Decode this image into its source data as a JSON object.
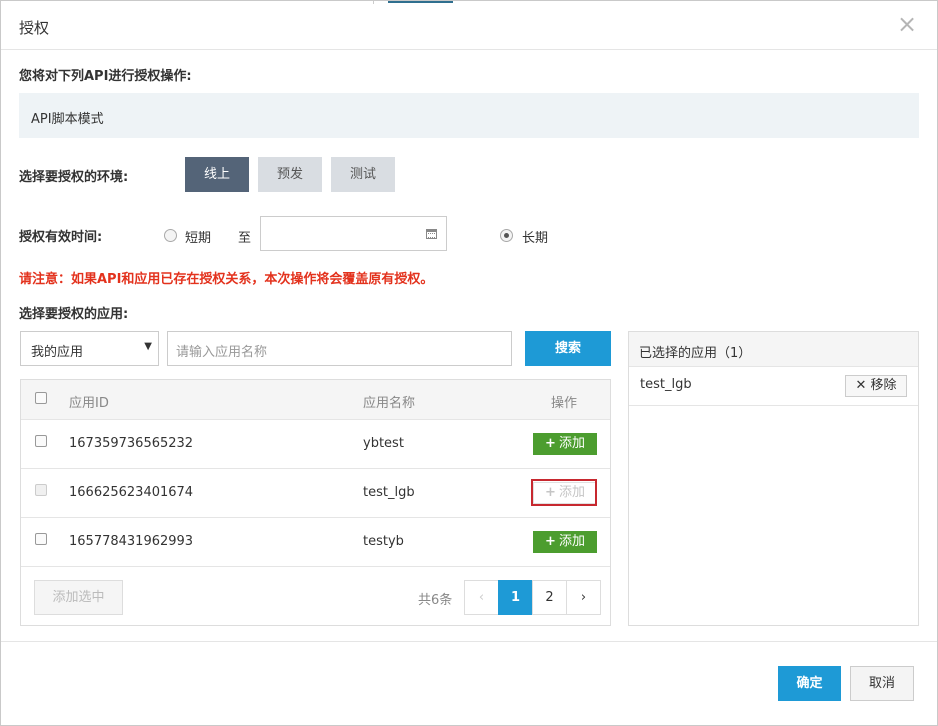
{
  "dialog": {
    "title": "授权",
    "close_glyph": "×"
  },
  "api_section": {
    "label": "您将对下列API进行授权操作:",
    "api_name": "API脚本模式"
  },
  "environment": {
    "label": "选择要授权的环境:",
    "options": [
      {
        "label": "线上",
        "active": true
      },
      {
        "label": "预发",
        "active": false
      },
      {
        "label": "测试",
        "active": false
      }
    ]
  },
  "validity": {
    "label": "授权有效时间:",
    "short_label": "短期",
    "to_label": "至",
    "date_value": "",
    "long_label": "长期",
    "selected": "长期"
  },
  "warning": "请注意：如果API和应用已存在授权关系，本次操作将会覆盖原有授权。",
  "apps": {
    "label": "选择要授权的应用:",
    "select_value": "我的应用",
    "search_placeholder": "请输入应用名称",
    "search_button": "搜索",
    "columns": {
      "id": "应用ID",
      "name": "应用名称",
      "action": "操作"
    },
    "rows": [
      {
        "id": "167359736565232",
        "name": "ybtest",
        "action": "添加",
        "disabled": false
      },
      {
        "id": "166625623401674",
        "name": "test_lgb",
        "action": "添加",
        "disabled": true
      },
      {
        "id": "165778431962993",
        "name": "testyb",
        "action": "添加",
        "disabled": false
      }
    ],
    "add_selected": "添加选中",
    "total": "共6条",
    "pagination": {
      "prev": "‹",
      "pages": [
        "1",
        "2"
      ],
      "current": "1",
      "next": "›"
    }
  },
  "selected_panel": {
    "title": "已选择的应用（1）",
    "items": [
      {
        "name": "test_lgb",
        "remove_label": "移除"
      }
    ]
  },
  "footer": {
    "ok": "确定",
    "cancel": "取消"
  },
  "colors": {
    "primary": "#1e9ad6",
    "env_active": "#546478",
    "add_green": "#4c9d2f",
    "warning_red": "#e3321d",
    "highlight_red": "#c7282f"
  }
}
